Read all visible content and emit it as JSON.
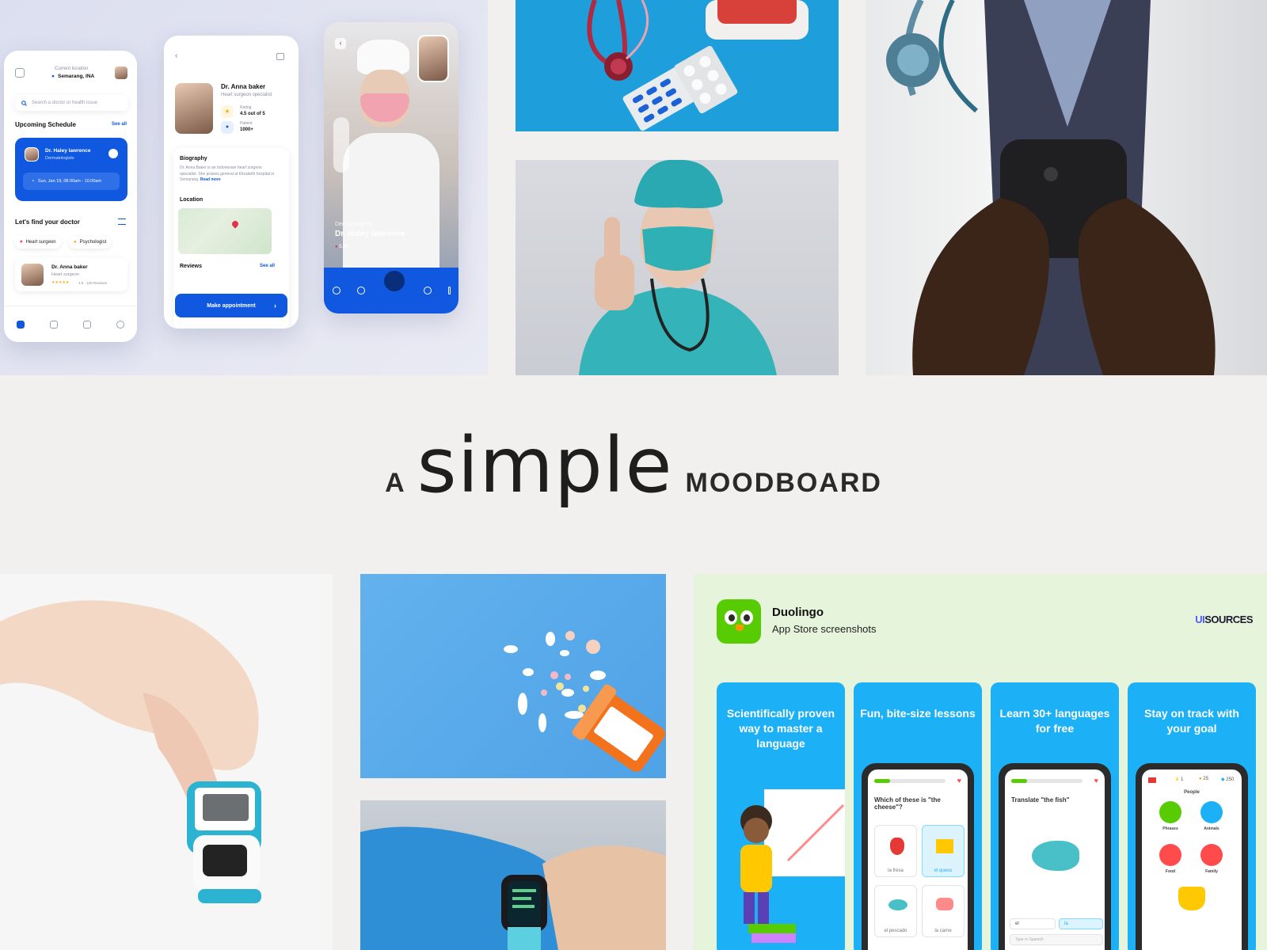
{
  "title": {
    "prefix": "A",
    "main": "simple",
    "suffix": "MOODBOARD"
  },
  "app_mockups": {
    "home": {
      "location_label": "Current location",
      "location_value": "Semarang, INA",
      "search_placeholder": "Search a doctor or health issue",
      "schedule_heading": "Upcoming Schedule",
      "see_all": "See all",
      "schedule_doctor": "Dr. Haley lawrence",
      "schedule_specialty": "Dermatologists",
      "schedule_time": "Sun, Jan 19, 08.00am - 10.00am",
      "find_heading": "Let's find your doctor",
      "chip_1": "Heart surgeon",
      "chip_2": "Psychologist",
      "doctor_name": "Dr. Anna baker",
      "doctor_specialty": "Heart surgeon",
      "doctor_rating": "4.5 · 120 Reviews"
    },
    "profile": {
      "doctor_name": "Dr. Anna baker",
      "doctor_specialty": "Heart surgeon specialist",
      "rating_label": "Rating",
      "rating_value": "4.5 out of 5",
      "patient_label": "Patient",
      "patient_value": "1000+",
      "bio_heading": "Biography",
      "bio_text": "Dr. Anna Baker is an Indonesian heart surgeon specialist. She praises general at Elizabeth hospital in Semarang.",
      "read_more": "Read more",
      "location_heading": "Location",
      "reviews_heading": "Reviews",
      "see_all": "See all",
      "cta": "Make appointment"
    },
    "video_call": {
      "specialty": "Dermatologists",
      "doctor_name": "Dr. Haley lawrence",
      "duration": "5.46"
    }
  },
  "duolingo": {
    "app_name": "Duolingo",
    "subtitle": "App Store screenshots",
    "brand_prefix": "UI",
    "brand_suffix": "SOURCES",
    "cards": [
      {
        "caption": "Scientifically proven way to master a language"
      },
      {
        "caption": "Fun, bite-size lessons",
        "question": "Which of these is \"the cheese\"?",
        "options": [
          "la fresa",
          "el queso",
          "el pescado",
          "la carne"
        ]
      },
      {
        "caption": "Learn 30+ languages for free",
        "question": "Translate \"the fish\"",
        "words": [
          "el",
          "la"
        ],
        "input_placeholder": "Type in Spanish"
      },
      {
        "caption": "Stay on track with your goal",
        "top_stats": [
          "1",
          "25",
          "250"
        ],
        "section": "People",
        "items": [
          "Phrases",
          "Animals",
          "Food",
          "Family"
        ]
      }
    ]
  },
  "photos": [
    {
      "icon": "first-aid-kit-photo"
    },
    {
      "icon": "surgeon-thumbs-up-photo"
    },
    {
      "icon": "doctor-smartphone-photo"
    },
    {
      "icon": "pulse-oximeter-photo"
    },
    {
      "icon": "pills-bottle-photo"
    },
    {
      "icon": "smartwatch-photo"
    }
  ],
  "colors": {
    "background": "#f1f0ee",
    "app_blue": "#1058e0",
    "duo_blue": "#1cb0f6",
    "duo_green": "#58cc02",
    "duo_bg": "#e6f4dc"
  }
}
